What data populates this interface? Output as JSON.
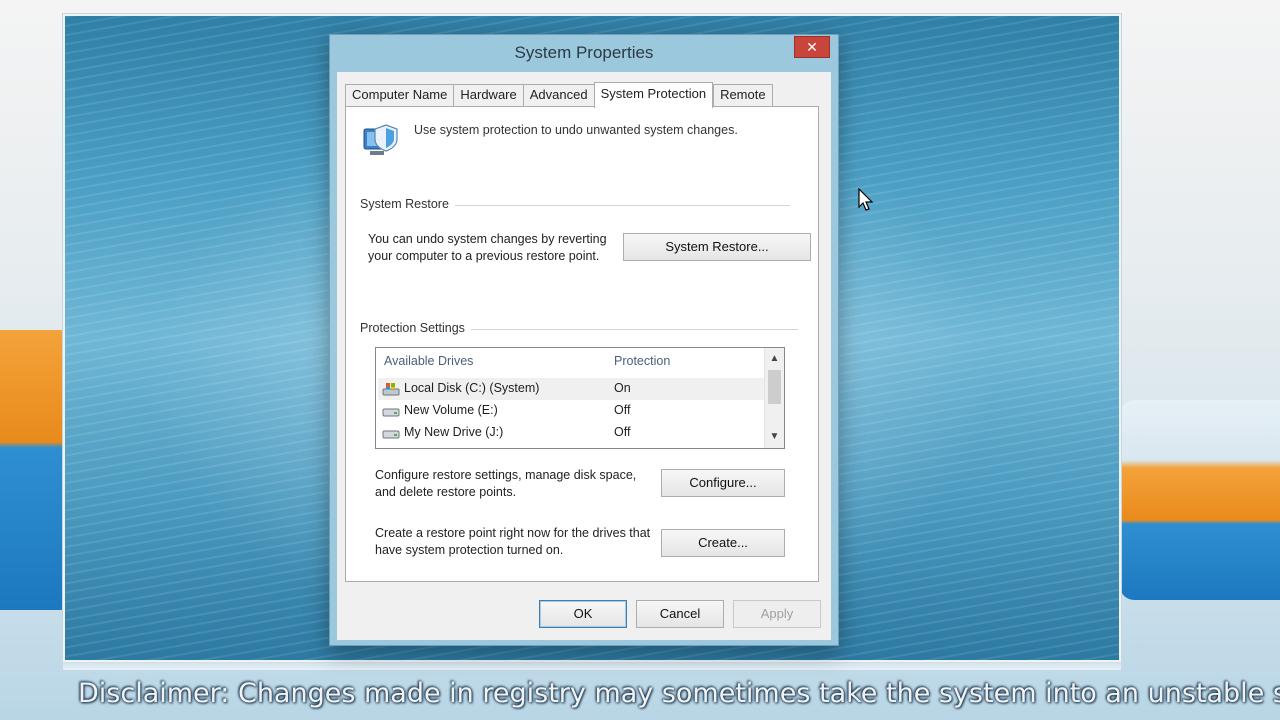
{
  "window": {
    "title": "System Properties",
    "close_glyph": "✕"
  },
  "tabs": [
    {
      "label": "Computer Name"
    },
    {
      "label": "Hardware"
    },
    {
      "label": "Advanced"
    },
    {
      "label": "System Protection",
      "active": true
    },
    {
      "label": "Remote"
    }
  ],
  "panel": {
    "intro": "Use system protection to undo unwanted system changes.",
    "system_restore": {
      "group_label": "System Restore",
      "description_line1": "You can undo system changes by reverting",
      "description_line2": "your computer to a previous restore point.",
      "button_label": "System Restore..."
    },
    "protection_settings": {
      "group_label": "Protection Settings",
      "columns": {
        "drive": "Available Drives",
        "protection": "Protection"
      },
      "drives": [
        {
          "name": "Local Disk (C:) (System)",
          "protection": "On",
          "icon": "system-drive-icon",
          "selected": true
        },
        {
          "name": "New Volume (E:)",
          "protection": "Off",
          "icon": "hard-drive-icon"
        },
        {
          "name": "My New Drive (J:)",
          "protection": "Off",
          "icon": "hard-drive-icon"
        }
      ],
      "configure_desc_line1": "Configure restore settings, manage disk space,",
      "configure_desc_line2": "and delete restore points.",
      "configure_label": "Configure...",
      "create_desc_line1": "Create a restore point right now for the drives that",
      "create_desc_line2": "have system protection turned on.",
      "create_label": "Create..."
    }
  },
  "footer": {
    "ok_label": "OK",
    "cancel_label": "Cancel",
    "apply_label": "Apply"
  },
  "caption": "Disclaimer: Changes made in registry may sometimes take the system into an unstable s",
  "colors": {
    "close_red": "#c7453b",
    "window_frame": "#9cc8de",
    "desktop_blue": "#4a9ec4"
  }
}
